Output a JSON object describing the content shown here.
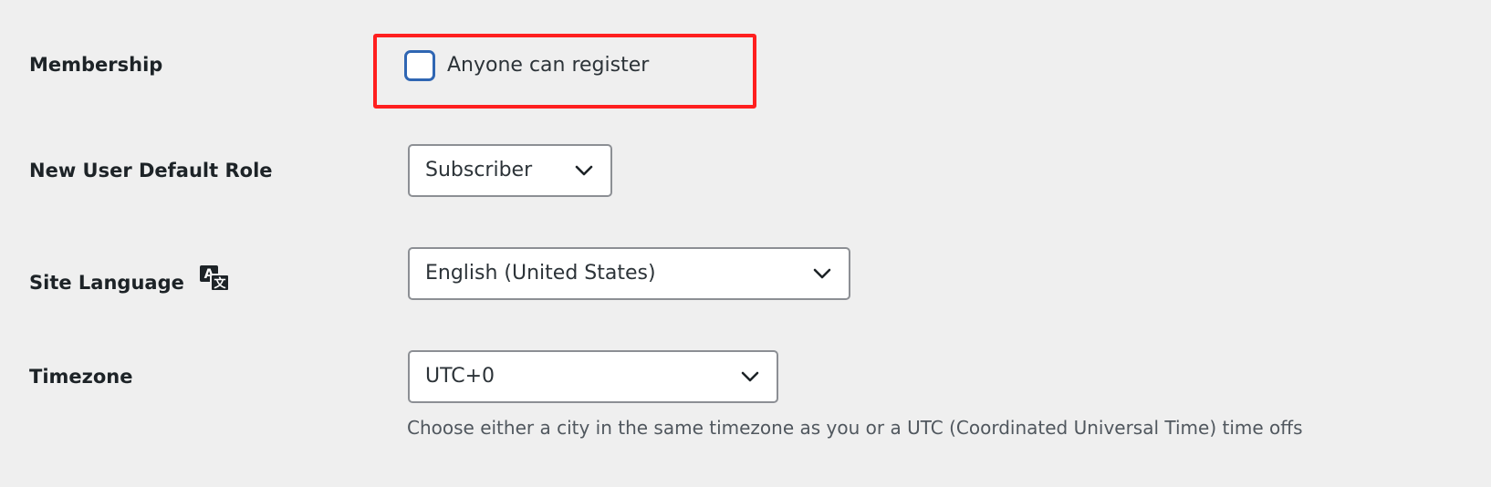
{
  "membership": {
    "label": "Membership",
    "checkbox_label": "Anyone can register",
    "checked": false,
    "highlight_color": "#ff1f1f"
  },
  "default_role": {
    "label": "New User Default Role",
    "selected": "Subscriber"
  },
  "site_language": {
    "label": "Site Language",
    "icon": "translation-icon",
    "selected": "English (United States)"
  },
  "timezone": {
    "label": "Timezone",
    "selected": "UTC+0",
    "description": "Choose either a city in the same timezone as you or a UTC (Coordinated Universal Time) time offs"
  },
  "colors": {
    "background": "#efefef",
    "checkbox_border": "#2f66b3",
    "text": "#1d2327",
    "muted_text": "#50575e"
  }
}
